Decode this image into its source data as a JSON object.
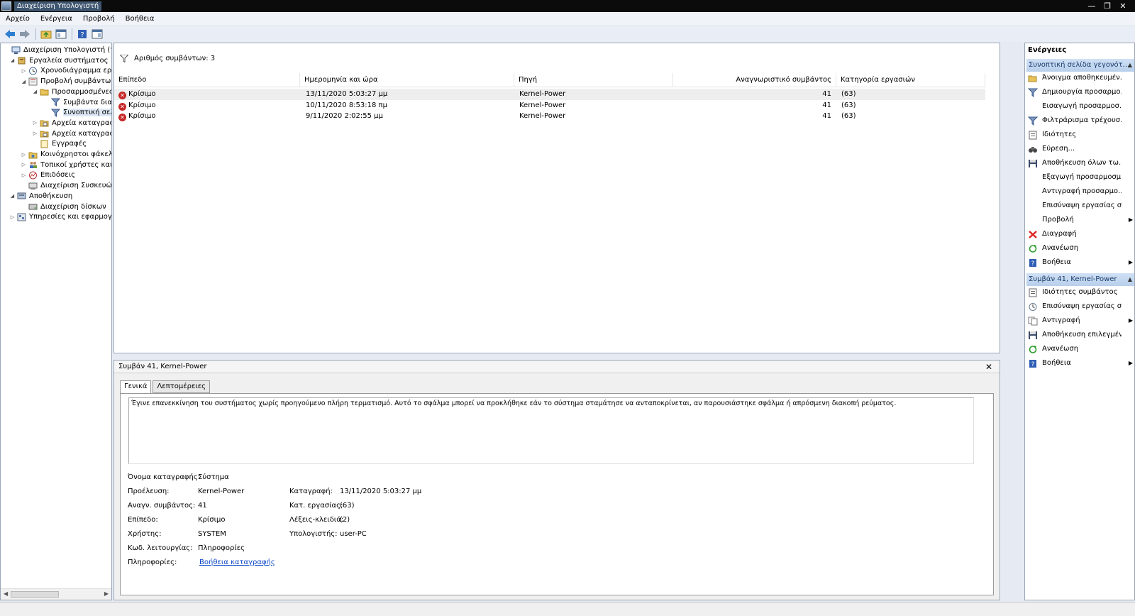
{
  "window": {
    "title": "Διαχείριση Υπολογιστή",
    "controls": [
      "—",
      "❐",
      "✕"
    ]
  },
  "menu": [
    "Αρχείο",
    "Ενέργεια",
    "Προβολή",
    "Βοήθεια"
  ],
  "tree": [
    {
      "label": "Διαχείριση Υπολογιστή (τοπικ",
      "expander": "",
      "icon": "computer-icon"
    },
    {
      "label": "Εργαλεία συστήματος",
      "expander": "◢",
      "icon": "tools-icon"
    },
    {
      "label": "Χρονοδιάγραμμα εργας",
      "expander": "▷",
      "icon": "clock-icon"
    },
    {
      "label": "Προβολή συμβάντων",
      "expander": "◢",
      "icon": "event-viewer-icon"
    },
    {
      "label": "Προσαρμοσμένες π",
      "expander": "◢",
      "icon": "folder-icon"
    },
    {
      "label": "Συμβάντα διαχεί",
      "expander": "",
      "icon": "filter-icon"
    },
    {
      "label": "Συνοπτική σελίδ",
      "expander": "",
      "icon": "filter-icon"
    },
    {
      "label": "Αρχεία καταγραφής",
      "expander": "▷",
      "icon": "log-folder-icon"
    },
    {
      "label": "Αρχεία καταγραφής",
      "expander": "▷",
      "icon": "log-folder-icon"
    },
    {
      "label": "Εγγραφές",
      "expander": "",
      "icon": "subscriptions-icon"
    },
    {
      "label": "Κοινόχρηστοι φάκελοι",
      "expander": "▷",
      "icon": "shared-folder-icon"
    },
    {
      "label": "Τοπικοί χρήστες και ομ",
      "expander": "▷",
      "icon": "users-icon"
    },
    {
      "label": "Επιδόσεις",
      "expander": "▷",
      "icon": "performance-icon"
    },
    {
      "label": "Διαχείριση Συσκευών",
      "expander": "",
      "icon": "device-manager-icon"
    },
    {
      "label": "Αποθήκευση",
      "expander": "◢",
      "icon": "storage-icon"
    },
    {
      "label": "Διαχείριση δίσκων",
      "expander": "",
      "icon": "disk-icon"
    },
    {
      "label": "Υπηρεσίες και εφαρμογές",
      "expander": "▷",
      "icon": "services-icon"
    }
  ],
  "events": {
    "count_label": "Αριθμός συμβάντων: 3",
    "columns": [
      "Επίπεδο",
      "Ημερομηνία και ώρα",
      "Πηγή",
      "Αναγνωριστικό συμβάντος",
      "Κατηγορία εργασιών"
    ],
    "rows": [
      {
        "level": "Κρίσιμο",
        "datetime": "13/11/2020 5:03:27 μμ",
        "source": "Kernel-Power",
        "id": "41",
        "task": "(63)"
      },
      {
        "level": "Κρίσιμο",
        "datetime": "10/11/2020 8:53:18 πμ",
        "source": "Kernel-Power",
        "id": "41",
        "task": "(63)"
      },
      {
        "level": "Κρίσιμο",
        "datetime": "9/11/2020 2:02:55 μμ",
        "source": "Kernel-Power",
        "id": "41",
        "task": "(63)"
      }
    ]
  },
  "detail": {
    "title": "Συμβάν 41, Kernel-Power",
    "close": "✕",
    "tabs": [
      "Γενικά",
      "Λεπτομέρειες"
    ],
    "description": "Έγινε επανεκκίνηση του συστήματος χωρίς προηγούμενο πλήρη τερματισμό. Αυτό το σφάλμα μπορεί να προκλήθηκε εάν το σύστημα σταμάτησε να ανταποκρίνεται, αν παρουσιάστηκε σφάλμα ή απρόσμενη διακοπή ρεύματος.",
    "props": {
      "log_name_label": "Όνομα καταγραφής:",
      "log_name": "Σύστημα",
      "source_label": "Προέλευση:",
      "source": "Kernel-Power",
      "logged_label": "Καταγραφή:",
      "logged": "13/11/2020 5:03:27 μμ",
      "event_id_label": "Αναγν. συμβάντος:",
      "event_id": "41",
      "task_label": "Κατ. εργασίας:",
      "task": "(63)",
      "level_label": "Επίπεδο:",
      "level": "Κρίσιμο",
      "keywords_label": "Λέξεις-κλειδιά:",
      "keywords": "(2)",
      "user_label": "Χρήστης:",
      "user": "SYSTEM",
      "computer_label": "Υπολογιστής:",
      "computer": "user-PC",
      "opcode_label": "Κωδ. λειτουργίας:",
      "opcode": "Πληροφορίες",
      "info_label": "Πληροφορίες:",
      "info_link": "Βοήθεια καταγραφής"
    }
  },
  "actions": {
    "header": "Ενέργειες",
    "section1": "Συνοπτική σελίδα γεγονότ...",
    "items1": [
      {
        "label": "Άνοιγμα αποθηκευμέν...",
        "icon": "open-folder-icon",
        "sub": ""
      },
      {
        "label": "Δημιουργία προσαρμο...",
        "icon": "create-filter-icon",
        "sub": ""
      },
      {
        "label": "Εισαγωγή προσαρμοσ...",
        "icon": "",
        "sub": ""
      },
      {
        "label": "Φιλτράρισμα τρέχουσ...",
        "icon": "filter-icon",
        "sub": ""
      },
      {
        "label": "Ιδιότητες",
        "icon": "properties-icon",
        "sub": ""
      },
      {
        "label": "Εύρεση...",
        "icon": "binoculars-icon",
        "sub": ""
      },
      {
        "label": "Αποθήκευση όλων τω...",
        "icon": "save-icon",
        "sub": ""
      },
      {
        "label": "Εξαγωγή προσαρμοσμ...",
        "icon": "",
        "sub": ""
      },
      {
        "label": "Αντιγραφή προσαρμο...",
        "icon": "",
        "sub": ""
      },
      {
        "label": "Επισύναψη εργασίας σ...",
        "icon": "",
        "sub": ""
      },
      {
        "label": "Προβολή",
        "icon": "",
        "sub": "▶"
      },
      {
        "label": "Διαγραφή",
        "icon": "delete-icon",
        "sub": ""
      },
      {
        "label": "Ανανέωση",
        "icon": "refresh-icon",
        "sub": ""
      },
      {
        "label": "Βοήθεια",
        "icon": "help-icon",
        "sub": "▶"
      }
    ],
    "section2": "Συμβάν 41, Kernel-Power",
    "items2": [
      {
        "label": "Ιδιότητες συμβάντος",
        "icon": "event-properties-icon",
        "sub": ""
      },
      {
        "label": "Επισύναψη εργασίας σ...",
        "icon": "attach-task-icon",
        "sub": ""
      },
      {
        "label": "Αντιγραφή",
        "icon": "copy-icon",
        "sub": "▶"
      },
      {
        "label": "Αποθήκευση επιλεγμέν...",
        "icon": "save-icon",
        "sub": ""
      },
      {
        "label": "Ανανέωση",
        "icon": "refresh-icon",
        "sub": ""
      },
      {
        "label": "Βοήθεια",
        "icon": "help-icon",
        "sub": "▶"
      }
    ]
  },
  "colors": {
    "error": "#c62828",
    "section": "#b8cfeb",
    "link": "#0b46c6",
    "selection": "#dde8f5"
  }
}
